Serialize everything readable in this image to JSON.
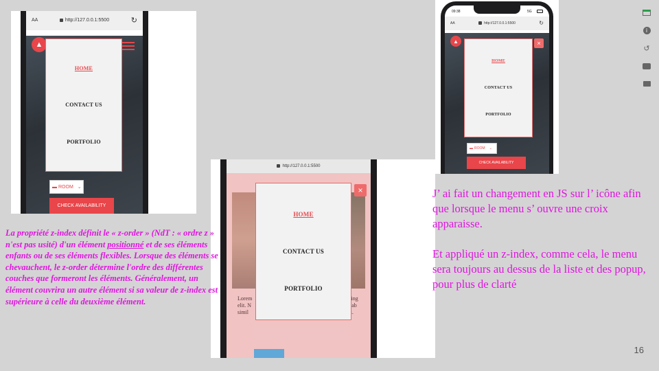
{
  "screenshot_left": {
    "urlbar": {
      "aa": "AA",
      "url": "http://127.0.0.1:5500",
      "reload": "↻"
    },
    "menu": {
      "items": [
        "HOME",
        "CONTACT US",
        "PORTFOLIO"
      ]
    },
    "room_select": "ROOM",
    "cta": "CHECK AVAILABILITY"
  },
  "screenshot_center": {
    "urlbar": {
      "url": "http://127.0.0.1:5500"
    },
    "menu": {
      "items": [
        "HOME",
        "CONTACT US",
        "PORTFOLIO"
      ]
    },
    "close_icon": "×",
    "lorem_left": "Lorem\nelit. N\nsimil",
    "lorem_right": "cing\nt ab\nri."
  },
  "screenshot_right": {
    "status": {
      "time": "09:38",
      "signal": "5G"
    },
    "urlbar": {
      "aa": "AA",
      "url": "http://127.0.0.1:5500",
      "reload": "↻"
    },
    "menu": {
      "items": [
        "HOME",
        "CONTACT US",
        "PORTFOLIO"
      ]
    },
    "close_icon": "×",
    "room_select": "ROOM",
    "cta": "CHECK AVAILABILITY"
  },
  "left_text": {
    "part1": "La propriété z-index définit le « z-order » (NdT : « ordre z » n'est pas usité) d'un élément ",
    "underlined": "positionné",
    "part2": " et de ses éléments enfants ou de ses éléments flexibles. Lorsque des éléments se chevauchent, le z-order détermine l'ordre des différentes couches que formeront les éléments. Généralement, un élément couvrira un autre élément si sa valeur de z-index est supérieure à celle du deuxième élément."
  },
  "right_text": {
    "para1": "J’ ai fait un changement en JS sur l’ icône afin que lorsque le menu s’ ouvre une croix apparaisse.",
    "para2": "Et appliqué un z-index, comme cela, le menu sera toujours au dessus de la liste et des popup, pour plus de clarté"
  },
  "page_number": "16",
  "colors": {
    "accent": "#e8464a",
    "annotation": "#e014e0",
    "slide_bg": "#d4d4d4"
  },
  "sidebar_icons": [
    "new-device-icon",
    "info-icon",
    "rotate-icon",
    "camera-icon",
    "video-icon"
  ]
}
